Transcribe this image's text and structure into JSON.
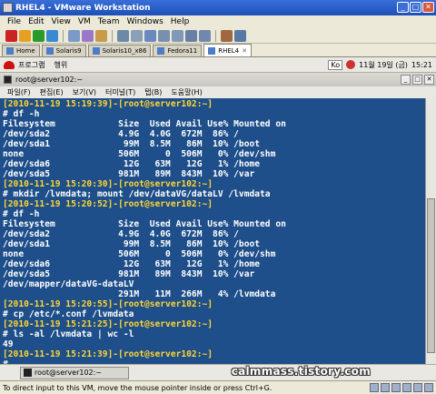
{
  "vmware": {
    "title": "RHEL4 - VMware Workstation",
    "menu": [
      "File",
      "Edit",
      "View",
      "VM",
      "Team",
      "Windows",
      "Help"
    ],
    "tabs": [
      {
        "label": "Home",
        "active": false
      },
      {
        "label": "Solaris9",
        "active": false
      },
      {
        "label": "Solaris10_x86",
        "active": false
      },
      {
        "label": "Fedora11",
        "active": false
      },
      {
        "label": "RHEL4",
        "active": true
      }
    ],
    "status": "To direct input to this VM, move the mouse pointer inside or press Ctrl+G."
  },
  "guest_panel": {
    "menu": [
      "프로그램",
      "행위"
    ],
    "kbd": "Ko",
    "date": "11월 19일 (금)",
    "time": "15:21"
  },
  "terminal": {
    "title": "root@server102:~",
    "menu": [
      "파일(F)",
      "편집(E)",
      "보기(V)",
      "터미널(T)",
      "탭(B)",
      "도움말(H)"
    ],
    "lines": [
      {
        "text": "[2010-11-19 15:19:39]-[root@server102:~]",
        "type": "prompt"
      },
      {
        "text": "# df -h",
        "type": "out"
      },
      {
        "text": "Filesystem            Size  Used Avail Use% Mounted on",
        "type": "out"
      },
      {
        "text": "/dev/sda2             4.9G  4.0G  672M  86% /",
        "type": "out"
      },
      {
        "text": "/dev/sda1              99M  8.5M   86M  10% /boot",
        "type": "out"
      },
      {
        "text": "none                  506M     0  506M   0% /dev/shm",
        "type": "out"
      },
      {
        "text": "/dev/sda6              12G   63M   12G   1% /home",
        "type": "out"
      },
      {
        "text": "/dev/sda5             981M   89M  843M  10% /var",
        "type": "out"
      },
      {
        "text": "[2010-11-19 15:20:30]-[root@server102:~]",
        "type": "prompt"
      },
      {
        "text": "# mkdir /lvmdata; mount /dev/dataVG/dataLV /lvmdata",
        "type": "out"
      },
      {
        "text": "[2010-11-19 15:20:52]-[root@server102:~]",
        "type": "prompt"
      },
      {
        "text": "# df -h",
        "type": "out"
      },
      {
        "text": "Filesystem            Size  Used Avail Use% Mounted on",
        "type": "out"
      },
      {
        "text": "/dev/sda2             4.9G  4.0G  672M  86% /",
        "type": "out"
      },
      {
        "text": "/dev/sda1              99M  8.5M   86M  10% /boot",
        "type": "out"
      },
      {
        "text": "none                  506M     0  506M   0% /dev/shm",
        "type": "out"
      },
      {
        "text": "/dev/sda6              12G   63M   12G   1% /home",
        "type": "out"
      },
      {
        "text": "/dev/sda5             981M   89M  843M  10% /var",
        "type": "out"
      },
      {
        "text": "/dev/mapper/dataVG-dataLV",
        "type": "out"
      },
      {
        "text": "                      291M   11M  266M   4% /lvmdata",
        "type": "out"
      },
      {
        "text": "[2010-11-19 15:20:55]-[root@server102:~]",
        "type": "prompt"
      },
      {
        "text": "# cp /etc/*.conf /lvmdata",
        "type": "out"
      },
      {
        "text": "[2010-11-19 15:21:25]-[root@server102:~]",
        "type": "prompt"
      },
      {
        "text": "# ls -al /lvmdata | wc -l",
        "type": "out"
      },
      {
        "text": "49",
        "type": "out"
      },
      {
        "text": "[2010-11-19 15:21:39]-[root@server102:~]",
        "type": "prompt"
      },
      {
        "text": "# ",
        "type": "out"
      }
    ]
  },
  "taskbar": {
    "task_label": "root@server102:~"
  },
  "watermark": "calmmass.tistory.com",
  "colors": {
    "terminal_bg": "#1e4f8a",
    "prompt": "#ffd633",
    "text": "#ffffff"
  }
}
